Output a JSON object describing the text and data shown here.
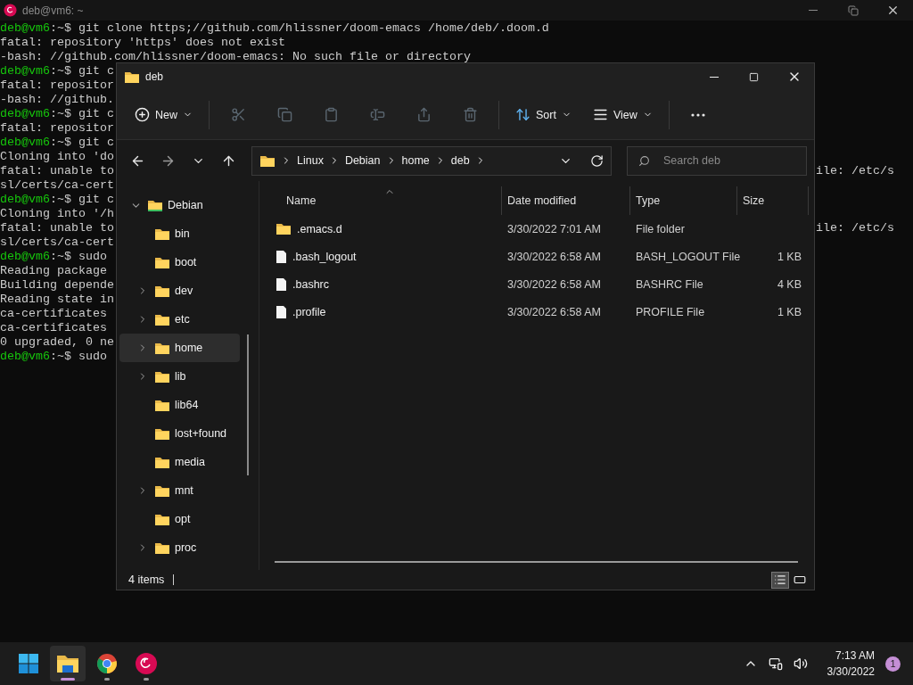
{
  "terminal": {
    "title": "deb@vm6: ~",
    "lines": [
      {
        "prompt": "deb@vm6",
        "text": ":~$ git clone https;//github.com/hlissner/doom-emacs /home/deb/.doom.d"
      },
      {
        "text": "fatal: repository 'https' does not exist"
      },
      {
        "text": "-bash: //github.com/hlissner/doom-emacs: No such file or directory"
      },
      {
        "prompt": "deb@vm6",
        "text": ":~$ git c"
      },
      {
        "text": "fatal: repositor"
      },
      {
        "text": "-bash: //github."
      },
      {
        "prompt": "deb@vm6",
        "text": ":~$ git c"
      },
      {
        "text": "fatal: repositor"
      },
      {
        "prompt": "deb@vm6",
        "text": ":~$ git c"
      },
      {
        "text": "Cloning into 'do"
      },
      {
        "text": "fatal: unable to",
        "right": "ile: /etc/s"
      },
      {
        "text": "sl/certs/ca-cert"
      },
      {
        "prompt": "deb@vm6",
        "text": ":~$ git c"
      },
      {
        "text": "Cloning into '/h"
      },
      {
        "text": "fatal: unable to",
        "right": "ile: /etc/s"
      },
      {
        "text": "sl/certs/ca-cert"
      },
      {
        "prompt": "deb@vm6",
        "text": ":~$ sudo"
      },
      {
        "text": "Reading package"
      },
      {
        "text": "Building depende"
      },
      {
        "text": "Reading state in"
      },
      {
        "text": "ca-certificates"
      },
      {
        "text": "ca-certificates"
      },
      {
        "text": "0 upgraded, 0 ne"
      },
      {
        "prompt": "deb@vm6",
        "text": ":~$ sudo"
      }
    ]
  },
  "explorer": {
    "title": "deb",
    "toolbar": {
      "new": {
        "label": "New"
      },
      "actions": [
        {
          "kind": "cut",
          "disabled": true
        },
        {
          "kind": "copy",
          "disabled": true
        },
        {
          "kind": "paste",
          "disabled": true
        },
        {
          "kind": "rename",
          "disabled": true
        },
        {
          "kind": "share",
          "disabled": true
        },
        {
          "kind": "delete",
          "disabled": true
        }
      ],
      "sort": {
        "label": "Sort"
      },
      "view": {
        "label": "View"
      }
    },
    "breadcrumbs": [
      "Linux",
      "Debian",
      "home",
      "deb"
    ],
    "search": {
      "placeholder": "Search deb"
    },
    "tree": [
      {
        "label": "Debian",
        "expandable": true,
        "expanded": true,
        "selected": false,
        "children": [
          {
            "label": "bin",
            "expandable": false,
            "expanded": false,
            "selected": false
          },
          {
            "label": "boot",
            "expandable": false,
            "expanded": false,
            "selected": false
          },
          {
            "label": "dev",
            "expandable": true,
            "expanded": false,
            "selected": false
          },
          {
            "label": "etc",
            "expandable": true,
            "expanded": false,
            "selected": false
          },
          {
            "label": "home",
            "expandable": true,
            "expanded": false,
            "selected": true
          },
          {
            "label": "lib",
            "expandable": true,
            "expanded": false,
            "selected": false
          },
          {
            "label": "lib64",
            "expandable": false,
            "expanded": false,
            "selected": false
          },
          {
            "label": "lost+found",
            "expandable": false,
            "expanded": false,
            "selected": false
          },
          {
            "label": "media",
            "expandable": false,
            "expanded": false,
            "selected": false
          },
          {
            "label": "mnt",
            "expandable": true,
            "expanded": false,
            "selected": false
          },
          {
            "label": "opt",
            "expandable": false,
            "expanded": false,
            "selected": false
          },
          {
            "label": "proc",
            "expandable": true,
            "expanded": false,
            "selected": false
          }
        ]
      }
    ],
    "columns": [
      {
        "label": "Name",
        "sorted": true
      },
      {
        "label": "Date modified",
        "sorted": false
      },
      {
        "label": "Type",
        "sorted": false
      },
      {
        "label": "Size",
        "sorted": false
      }
    ],
    "rows": [
      {
        "kind": "folder",
        "name": ".emacs.d",
        "date": "3/30/2022 7:01 AM",
        "type": "File folder"
      },
      {
        "kind": "file",
        "name": ".bash_logout",
        "date": "3/30/2022 6:58 AM",
        "type": "BASH_LOGOUT File",
        "size": "1 KB"
      },
      {
        "kind": "file",
        "name": ".bashrc",
        "date": "3/30/2022 6:58 AM",
        "type": "BASHRC File",
        "size": "4 KB"
      },
      {
        "kind": "file",
        "name": ".profile",
        "date": "3/30/2022 6:58 AM",
        "type": "PROFILE File",
        "size": "1 KB"
      }
    ],
    "status": "4 items",
    "views": [
      {
        "kind": "details",
        "selected": true
      },
      {
        "kind": "tiles",
        "selected": false
      }
    ]
  },
  "taskbar": {
    "apps": [
      {
        "kind": "start",
        "selected": false,
        "running": false
      },
      {
        "kind": "files",
        "selected": true,
        "running": true
      },
      {
        "kind": "browser",
        "selected": false,
        "running": true
      },
      {
        "kind": "terminal",
        "selected": false,
        "running": true
      }
    ],
    "time": "7:13 AM",
    "date": "3/30/2022",
    "badge": "1"
  }
}
